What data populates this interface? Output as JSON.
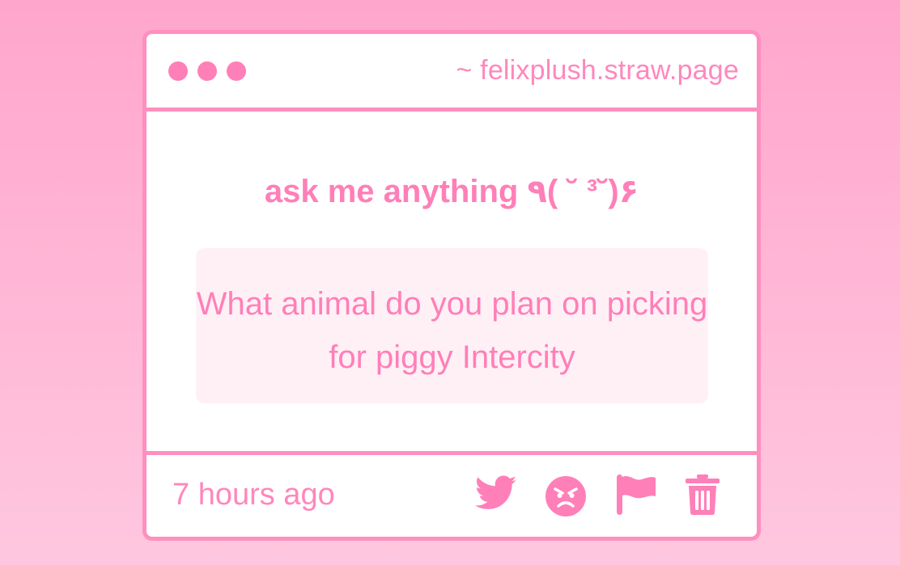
{
  "window": {
    "url": "~ felixplush.straw.page",
    "controls": [
      "dot",
      "dot",
      "dot"
    ]
  },
  "main": {
    "heading": "ask me anything ٩( ˘ ³˘)۶",
    "question": "What animal do you plan on picking for piggy Intercity"
  },
  "footer": {
    "timestamp": "7 hours ago",
    "actions": [
      "twitter-icon",
      "angry-face-icon",
      "flag-icon",
      "trash-icon"
    ]
  },
  "colors": {
    "background_top": "#ffa6cc",
    "background_bottom": "#ffc7df",
    "accent": "#ff7fb8",
    "border": "#ff8fbf",
    "question_bg": "#fff0f6"
  }
}
